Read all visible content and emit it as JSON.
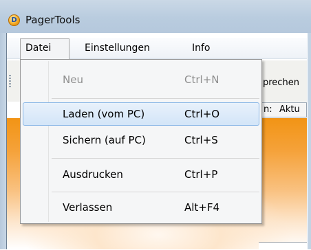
{
  "window": {
    "title": "PagerTools",
    "icon": "pagertools-app-icon",
    "icon_letter": "D"
  },
  "menubar": {
    "items": [
      {
        "label": "Datei"
      },
      {
        "label": "Einstellungen"
      },
      {
        "label": "Info"
      }
    ]
  },
  "toolbar": {
    "partial_text_1": "prechen",
    "partial_text_2": "n:",
    "partial_text_3": "Aktu"
  },
  "file_menu": {
    "items": [
      {
        "label": "Neu",
        "shortcut": "Ctrl+N",
        "enabled": false
      },
      {
        "label": "Laden (vom PC)",
        "shortcut": "Ctrl+O",
        "highlighted": true
      },
      {
        "label": "Sichern (auf PC)",
        "shortcut": "Ctrl+S"
      },
      {
        "label": "Ausdrucken",
        "shortcut": "Ctrl+P"
      },
      {
        "label": "Verlassen",
        "shortcut": "Alt+F4"
      }
    ]
  },
  "colors": {
    "accent_orange": "#f29415",
    "highlight_border": "#86b5e6",
    "titlebar": "#b9ccdf"
  }
}
